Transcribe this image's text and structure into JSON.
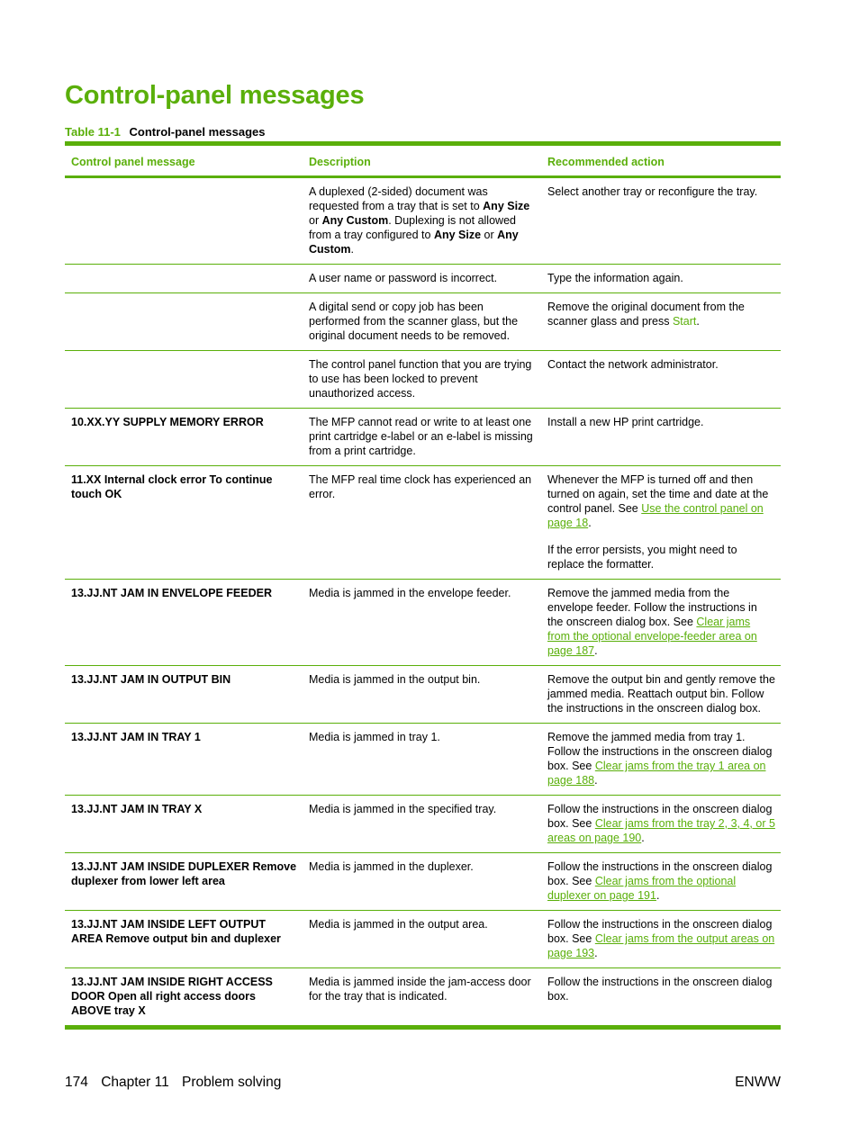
{
  "page": {
    "title": "Control-panel messages",
    "table_caption": {
      "number": "Table 11-1",
      "title": "Control-panel messages"
    }
  },
  "table": {
    "headers": [
      "Control panel message",
      "Description",
      "Recommended action"
    ],
    "rows": [
      {
        "message": "",
        "description_parts": [
          "A duplexed (2-sided) document was requested from a tray that is set to ",
          "Any Size",
          " or ",
          "Any Custom",
          ". Duplexing is not allowed from a tray configured to ",
          "Any Size",
          " or ",
          "Any Custom",
          "."
        ],
        "action_pre": "Select another tray or reconfigure the tray.",
        "action_link": "",
        "action_post": ""
      },
      {
        "message": "",
        "description": "A user name or password is incorrect.",
        "action_pre": "Type the information again.",
        "action_link": "",
        "action_post": ""
      },
      {
        "message": "",
        "description": "A digital send or copy job has been performed from the scanner glass, but the original document needs to be removed.",
        "action_pre": "Remove the original document from the scanner glass and press ",
        "action_highlight": "Start",
        "action_post": "."
      },
      {
        "message": "",
        "description": "The control panel function that you are trying to use has been locked to prevent unauthorized access.",
        "action_pre": "Contact the network administrator.",
        "action_link": "",
        "action_post": ""
      },
      {
        "message": "10.XX.YY SUPPLY MEMORY ERROR",
        "description": "The MFP cannot read or write to at least one print cartridge e-label or an e-label is missing from a print cartridge.",
        "action_pre": "Install a new HP print cartridge.",
        "action_link": "",
        "action_post": ""
      },
      {
        "message": "11.XX Internal clock error To continue touch OK",
        "description": "The MFP real time clock has experienced an error.",
        "action_pre": "Whenever the MFP is turned off and then turned on again, set the time and date at the control panel. See ",
        "action_link": "Use the control panel on page 18",
        "action_post": ".",
        "action_extra": "If the error persists, you might need to replace the formatter."
      },
      {
        "message": "13.JJ.NT JAM IN ENVELOPE FEEDER",
        "description": "Media is jammed in the envelope feeder.",
        "action_pre": "Remove the jammed media from the envelope feeder. Follow the instructions in the onscreen dialog box. See ",
        "action_link": "Clear jams from the optional envelope-feeder area on page 187",
        "action_post": "."
      },
      {
        "message": "13.JJ.NT JAM IN OUTPUT BIN",
        "description": "Media is jammed in the output bin.",
        "action_pre": "Remove the output bin and gently remove the jammed media. Reattach output bin. Follow the instructions in the onscreen dialog box.",
        "action_link": "",
        "action_post": ""
      },
      {
        "message": "13.JJ.NT JAM IN TRAY 1",
        "description": "Media is jammed in tray 1.",
        "action_pre": "Remove the jammed media from tray 1. Follow the instructions in the onscreen dialog box. See ",
        "action_link": "Clear jams from the tray 1 area on page 188",
        "action_post": "."
      },
      {
        "message": "13.JJ.NT JAM IN TRAY X",
        "description": "Media is jammed in the specified tray.",
        "action_pre": "Follow the instructions in the onscreen dialog box. See ",
        "action_link": "Clear jams from the tray 2, 3, 4, or 5 areas on page 190",
        "action_post": "."
      },
      {
        "message": "13.JJ.NT JAM INSIDE DUPLEXER Remove duplexer from lower left area",
        "description": "Media is jammed in the duplexer.",
        "action_pre": "Follow the instructions in the onscreen dialog box. See ",
        "action_link": "Clear jams from the optional duplexer on page 191",
        "action_post": "."
      },
      {
        "message": "13.JJ.NT JAM INSIDE LEFT OUTPUT AREA Remove output bin and duplexer",
        "description": "Media is jammed in the output area.",
        "action_pre": "Follow the instructions in the onscreen dialog box. See ",
        "action_link": "Clear jams from the output areas on page 193",
        "action_post": "."
      },
      {
        "message": "13.JJ.NT JAM INSIDE RIGHT ACCESS DOOR Open all right access doors ABOVE tray X",
        "description": "Media is jammed inside the jam-access door for the tray that is indicated.",
        "action_pre": "Follow the instructions in the onscreen dialog box.",
        "action_link": "",
        "action_post": ""
      }
    ]
  },
  "footer": {
    "page_number": "174",
    "chapter": "Chapter 11",
    "section": "Problem solving",
    "right": "ENWW"
  },
  "colors": {
    "accent": "#5aaf0a",
    "text": "#000000"
  }
}
